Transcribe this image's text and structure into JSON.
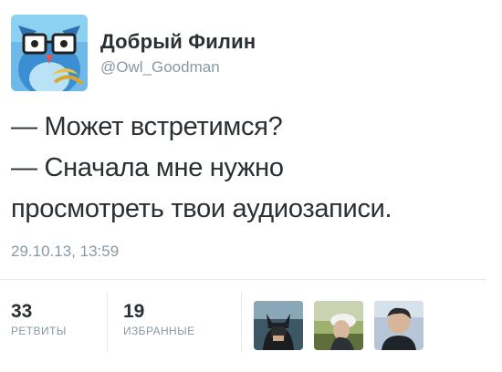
{
  "author": {
    "name": "Добрый Филин",
    "handle": "@Owl_Goodman",
    "avatar_icon": "owl-with-glasses-icon"
  },
  "tweet": {
    "lines": [
      "— Может встретимся?",
      "— Сначала мне нужно",
      "просмотреть твои аудиозаписи."
    ],
    "timestamp": "29.10.13, 13:59"
  },
  "stats": {
    "retweets": {
      "count": "33",
      "label": "РЕТВИТЫ"
    },
    "favorites": {
      "count": "19",
      "label": "ИЗБРАННЫЕ"
    }
  },
  "favorited_by": [
    {
      "icon": "batman-avatar"
    },
    {
      "icon": "person-cap-avatar"
    },
    {
      "icon": "person-portrait-avatar"
    }
  ],
  "colors": {
    "text": "#292f33",
    "secondary": "#8899a6",
    "divider": "#e1e8ed"
  }
}
